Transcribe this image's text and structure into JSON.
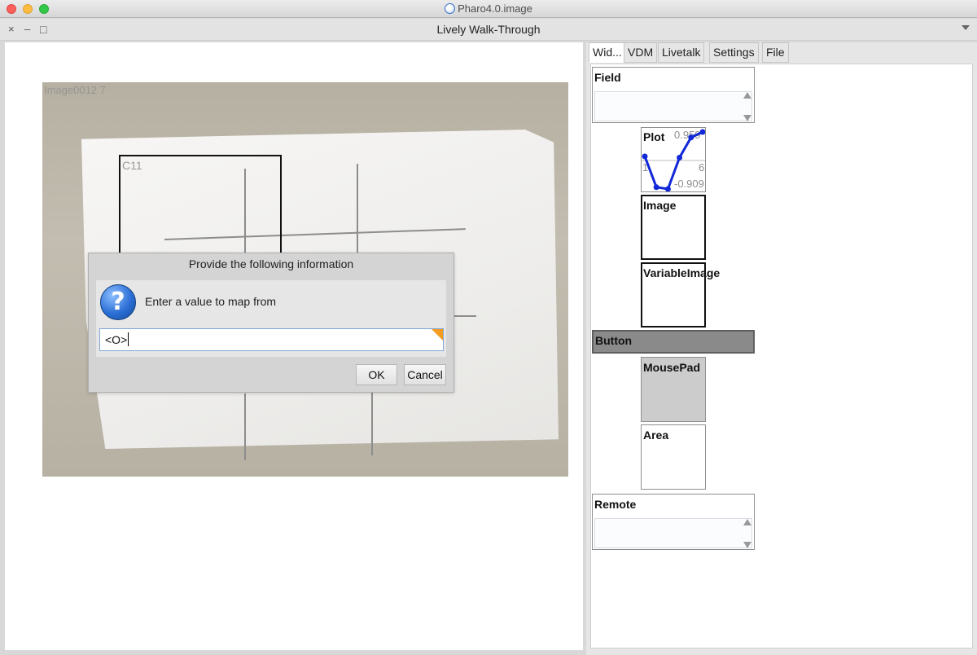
{
  "os_window": {
    "title": "Pharo4.0.image"
  },
  "window": {
    "title": "Lively Walk-Through",
    "close_glyph": "×",
    "minimize_glyph": "–",
    "maximize_glyph": "□"
  },
  "canvas": {
    "photo_label": "Image0012 7",
    "roi_label": "C11"
  },
  "dialog": {
    "title": "Provide the following information",
    "prompt": "Enter a value to map from",
    "icon_glyph": "?",
    "input_value": "<O>",
    "ok_label": "OK",
    "cancel_label": "Cancel"
  },
  "tabs": [
    {
      "label": "Wid..."
    },
    {
      "label": "VDM"
    },
    {
      "label": "Livetalk"
    },
    {
      "label": "Settings"
    },
    {
      "label": "File"
    }
  ],
  "widgets": {
    "field": "Field",
    "plot": {
      "label": "Plot",
      "max_label": "0.959",
      "min_label": "-0.909",
      "left_label": "1",
      "right_label": "6"
    },
    "image": "Image",
    "variable_image": "VariableImage",
    "button": "Button",
    "mousepad": "MousePad",
    "area": "Area",
    "remote": "Remote"
  },
  "plot_data": {
    "x": [
      1,
      2,
      3,
      4,
      5,
      6
    ],
    "y": [
      0.16,
      -0.85,
      -0.909,
      0.12,
      0.78,
      0.959
    ]
  },
  "colors": {
    "plot_line": "#1028d8",
    "button_bg": "#8a8a8a",
    "mousepad_bg": "#cccccc",
    "corner_flag": "#f39c20"
  }
}
